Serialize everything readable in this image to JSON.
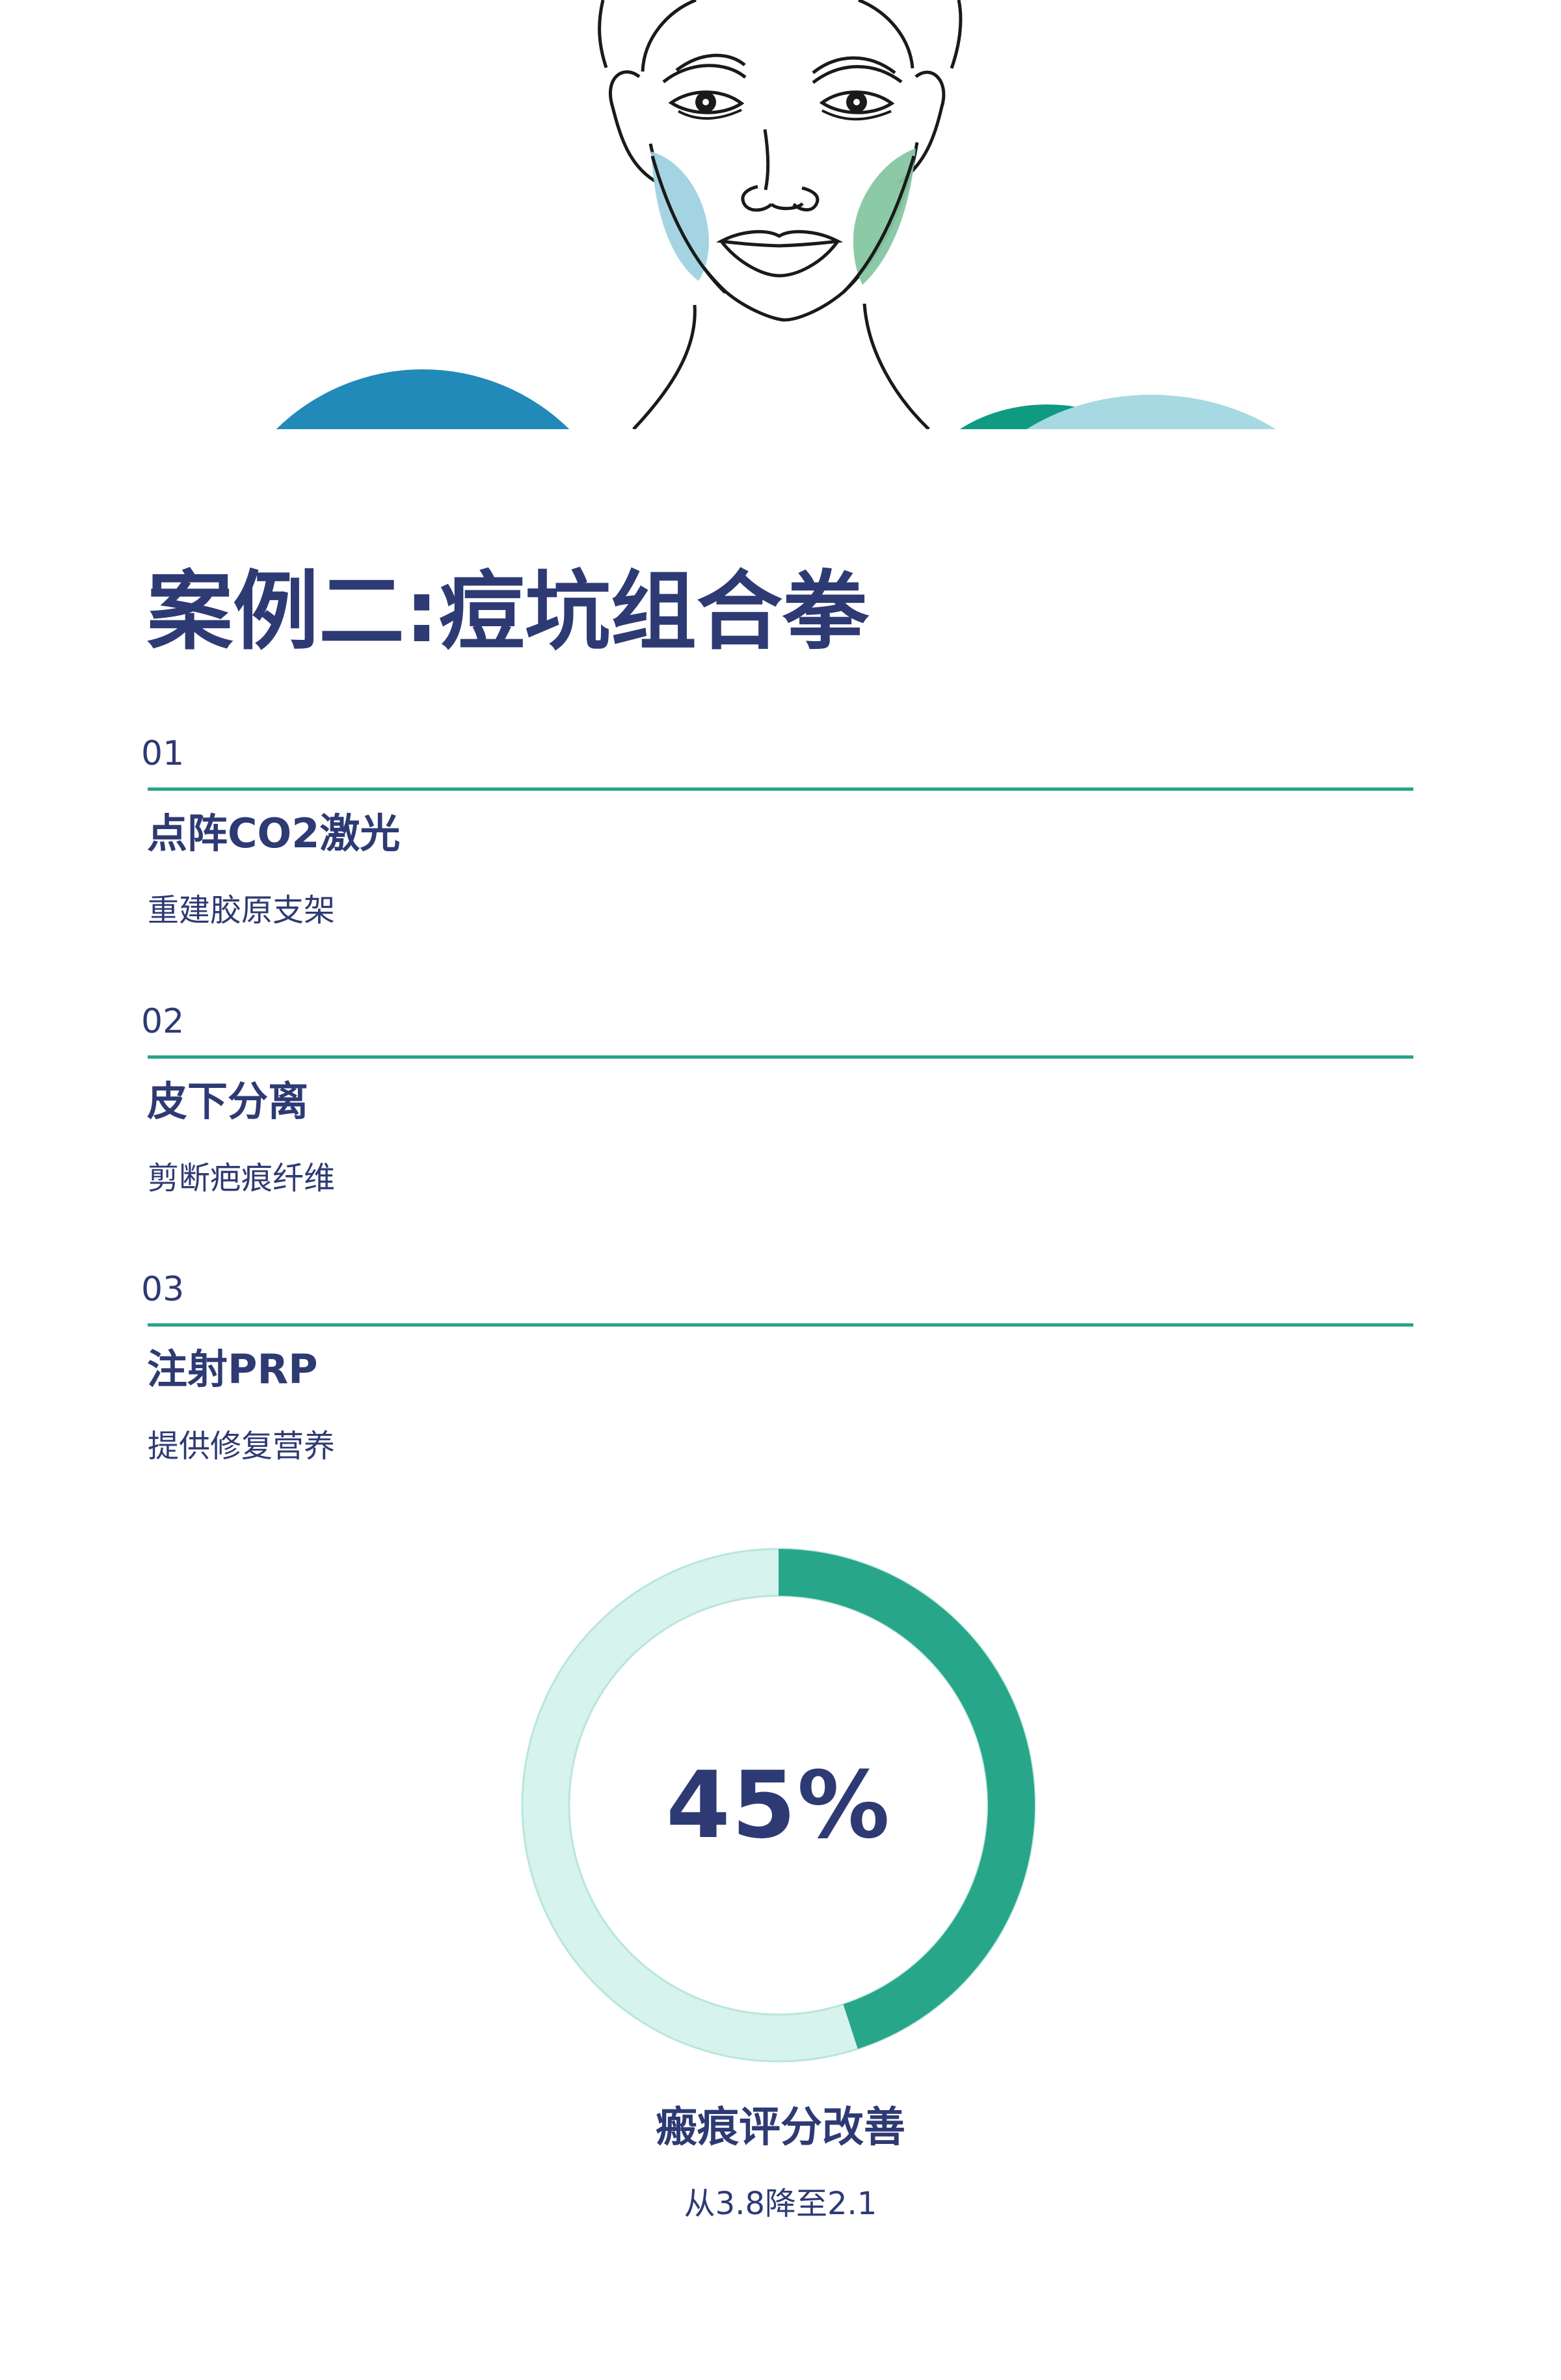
{
  "hero": {
    "illustration": "face-line-art-icon",
    "colors": {
      "outline": "#1a1a1a",
      "light_blue": "#9fd2e0",
      "mint_green": "#86c7a2",
      "deep_blue": "#218ab8",
      "teal": "#0f9a82",
      "pale_blue": "#a7d9e2"
    }
  },
  "page": {
    "title": "案例二:痘坑组合拳"
  },
  "steps": [
    {
      "number": "01",
      "title": "点阵CO2激光",
      "description": "重建胶原支架"
    },
    {
      "number": "02",
      "title": "皮下分离",
      "description": "剪断疤痕纤维"
    },
    {
      "number": "03",
      "title": "注射PRP",
      "description": "提供修复营养"
    }
  ],
  "metric": {
    "value_text": "45%",
    "progress": 0.45,
    "label": "瘢痕评分改善",
    "subtext": "从3.8降至2.1",
    "progress_color": "#28a689",
    "track_color": "#d6f3ed",
    "track_border_color": "#b8e6dc"
  },
  "colors": {
    "text": "#2e3a73",
    "accent_line": "#29a389",
    "background": "#ffffff"
  }
}
